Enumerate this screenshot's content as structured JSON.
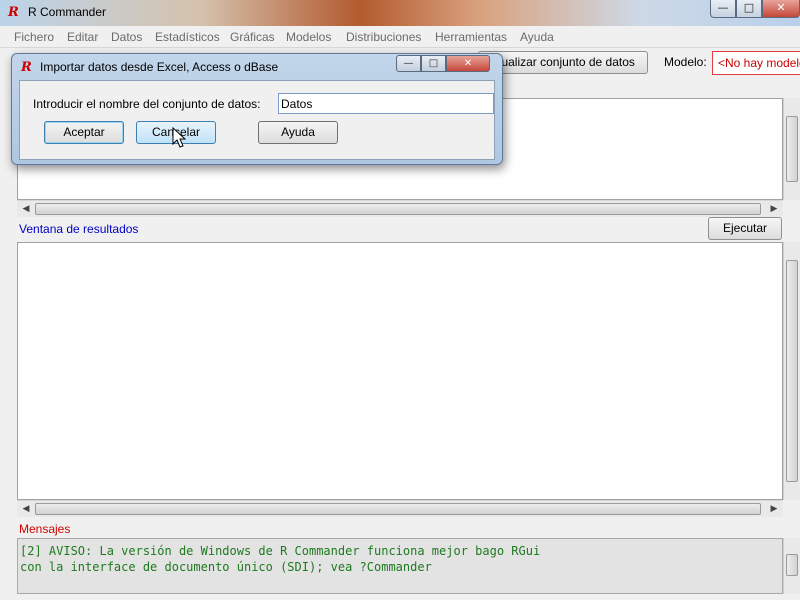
{
  "app": {
    "title": "R Commander",
    "logo_text": "R"
  },
  "menu": [
    "Fichero",
    "Editar",
    "Datos",
    "Estadísticos",
    "Gráficas",
    "Modelos",
    "Distribuciones",
    "Herramientas",
    "Ayuda"
  ],
  "toolbar": {
    "view_dataset_label": "Visualizar conjunto de datos",
    "model_label": "Modelo:",
    "model_value": "<No hay modelo activo>"
  },
  "results": {
    "label": "Ventana de resultados",
    "run_button": "Ejecutar"
  },
  "messages": {
    "label": "Mensajes",
    "text": "[2] AVISO: La versión de Windows de R Commander funciona mejor bago RGui\ncon la interface de documento único (SDI); vea ?Commander"
  },
  "dialog": {
    "title": "Importar datos desde Excel, Access o dBase",
    "prompt": "Introducir el nombre del conjunto de datos:",
    "input_value": "Datos",
    "ok_label": "Aceptar",
    "cancel_label": "Cancelar",
    "help_label": "Ayuda"
  },
  "colors": {
    "results_label": "#0000c8",
    "messages_label": "#d00000",
    "messages_text": "#1e7a1e"
  }
}
